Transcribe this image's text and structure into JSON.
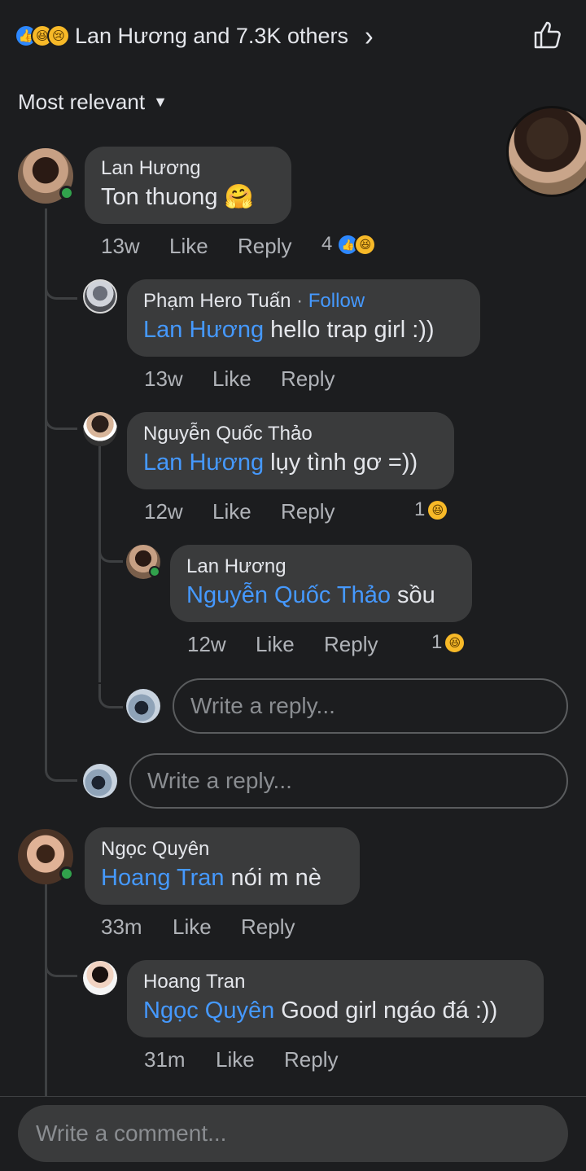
{
  "header": {
    "reaction_icons": [
      "like-icon",
      "haha-icon",
      "sad-icon"
    ],
    "reactions_summary": "Lan Hương and 7.3K others",
    "chevron": "›"
  },
  "sort": {
    "label": "Most relevant",
    "caret": "⌄"
  },
  "comments": [
    {
      "author": "Lan Hương",
      "text": "Ton thuong 🤗",
      "time": "13w",
      "like": "Like",
      "reply": "Reply",
      "reaction_count": "4",
      "replies": [
        {
          "author": "Phạm Hero Tuấn",
          "follow": "Follow",
          "mention": "Lan Hương",
          "text": " hello trap girl :))",
          "time": "13w",
          "like": "Like",
          "reply": "Reply"
        },
        {
          "author": "Nguyễn Quốc Thảo",
          "mention": "Lan Hương",
          "text": " lụy tình gơ =))",
          "time": "12w",
          "like": "Like",
          "reply": "Reply",
          "reaction_count": "1",
          "replies": [
            {
              "author": "Lan Hương",
              "mention": "Nguyễn Quốc Thảo",
              "text": " sồu",
              "time": "12w",
              "like": "Like",
              "reply": "Reply",
              "reaction_count": "1"
            }
          ],
          "reply_placeholder": "Write a reply..."
        }
      ],
      "reply_placeholder": "Write a reply..."
    },
    {
      "author": "Ngọc Quyên",
      "mention": "Hoang Tran",
      "text": " nói m nè",
      "time": "33m",
      "like": "Like",
      "reply": "Reply",
      "replies": [
        {
          "author": "Hoang Tran",
          "mention": "Ngọc Quyên",
          "text": " Good girl ngáo đá :))",
          "time": "31m",
          "like": "Like",
          "reply": "Reply"
        }
      ]
    }
  ],
  "composer": {
    "placeholder": "Write a comment..."
  },
  "colors": {
    "background": "#1c1d1f",
    "bubble": "#3a3b3c",
    "link": "#4599ff",
    "like_blue": "#2d88ff",
    "emoji_yellow": "#f7b928",
    "online": "#31a24c"
  }
}
